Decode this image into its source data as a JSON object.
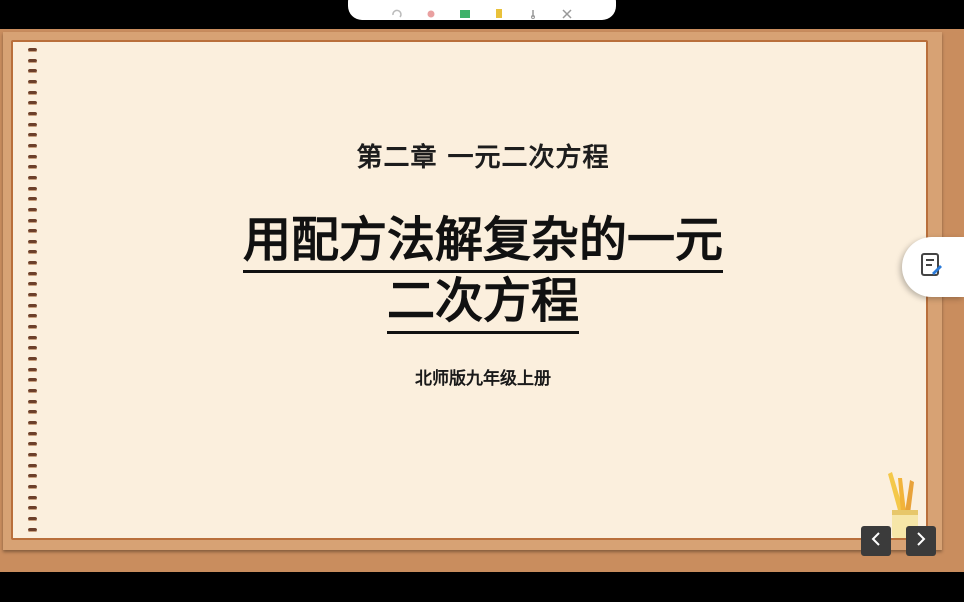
{
  "slide": {
    "chapter": "第二章  一元二次方程",
    "title_line1": "用配方法解复杂的一元",
    "title_line2": "二次方程",
    "subtitle": "北师版九年级上册"
  },
  "toolbar": {
    "icons": [
      "undo-icon",
      "record-icon",
      "whiteboard-icon",
      "highlighter-icon",
      "lasso-icon",
      "close-icon"
    ]
  },
  "side_panel": {
    "icon": "note-edit-icon"
  },
  "navigation": {
    "prev_icon": "chevron-left-icon",
    "next_icon": "chevron-right-icon"
  },
  "colors": {
    "frame": "#c98d5e",
    "paper": "#fbefdd",
    "paper_border": "#b96f3b",
    "ring": "#6c3f2a",
    "nav_button": "#3b3b3b"
  }
}
